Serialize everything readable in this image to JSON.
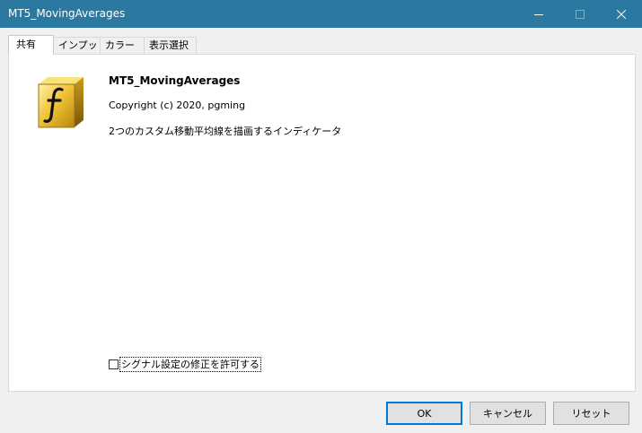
{
  "window": {
    "title": "MT5_MovingAverages",
    "controls": {
      "minimize_icon": "minimize-icon",
      "maximize_icon": "maximize-icon",
      "close_icon": "close-icon"
    },
    "titlebar_color": "#2b79a0"
  },
  "tabs": [
    {
      "label": "共有",
      "active": true
    },
    {
      "label": "インプット",
      "active": false
    },
    {
      "label": "カラー",
      "active": false
    },
    {
      "label": "表示選択",
      "active": false
    }
  ],
  "common": {
    "icon": "function-f-icon",
    "name": "MT5_MovingAverages",
    "copyright": "Copyright (c) 2020, pgming",
    "description": "2つのカスタム移動平均線を描画するインディケータ",
    "allow_signal_edit": {
      "label": "シグナル設定の修正を許可する",
      "checked": false
    }
  },
  "buttons": {
    "ok": "OK",
    "cancel": "キャンセル",
    "reset": "リセット"
  }
}
